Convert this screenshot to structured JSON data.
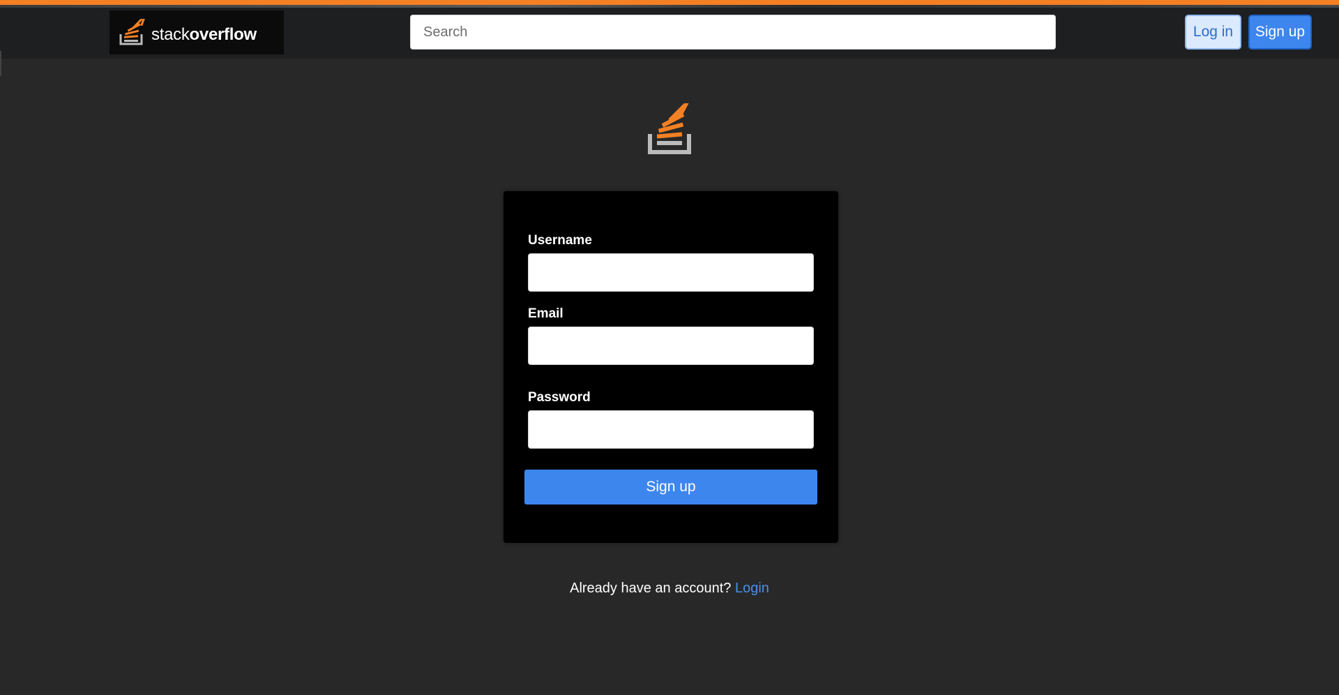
{
  "header": {
    "logo_text_light": "stack",
    "logo_text_bold": "overflow",
    "search_placeholder": "Search",
    "login_label": "Log in",
    "signup_label": "Sign up"
  },
  "form": {
    "username_label": "Username",
    "email_label": "Email",
    "password_label": "Password",
    "submit_label": "Sign up"
  },
  "footer": {
    "prompt": "Already have an account?",
    "link_label": "Login"
  },
  "colors": {
    "accent": "#f48024",
    "primary": "#3d86ee",
    "background": "#282828",
    "card": "#000000"
  },
  "icons": {
    "logo": "stackoverflow-logo-icon",
    "emblem": "stackoverflow-emblem-icon"
  }
}
